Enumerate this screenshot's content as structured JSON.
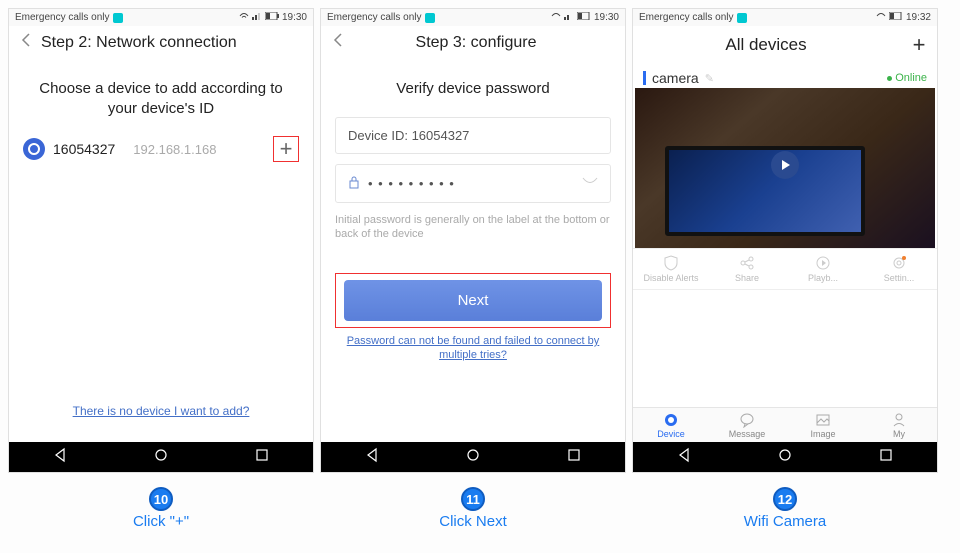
{
  "screen1": {
    "status": {
      "carrier": "Emergency calls only",
      "time": "19:30"
    },
    "header_title": "Step 2: Network connection",
    "subtitle": "Choose a device to add according to your device's ID",
    "device": {
      "id": "16054327",
      "ip": "192.168.1.168"
    },
    "no_device_link": "There is no device I want to add?"
  },
  "screen2": {
    "status": {
      "carrier": "Emergency calls only",
      "time": "19:30"
    },
    "header_title": "Step 3: configure",
    "subtitle": "Verify device password",
    "device_id_label": "Device ID: 16054327",
    "password_mask": "• • • • • • • • •",
    "hint": "Initial password is generally on the label at the bottom or back of the device",
    "next_button": "Next",
    "tries_link": "Password can not be found and failed to connect by multiple tries?"
  },
  "screen3": {
    "status": {
      "carrier": "Emergency calls only",
      "time": "19:32"
    },
    "header_title": "All devices",
    "camera_name": "camera",
    "online_label": "Online",
    "actions": {
      "disable": "Disable Alerts",
      "share": "Share",
      "playback": "Playb...",
      "settings": "Settin..."
    },
    "nav": {
      "device": "Device",
      "message": "Message",
      "image": "Image",
      "my": "My"
    }
  },
  "captions": {
    "c10": {
      "num": "10",
      "text": "Click \"+\""
    },
    "c11": {
      "num": "11",
      "text": "Click Next"
    },
    "c12": {
      "num": "12",
      "text": "Wifi Camera"
    }
  }
}
